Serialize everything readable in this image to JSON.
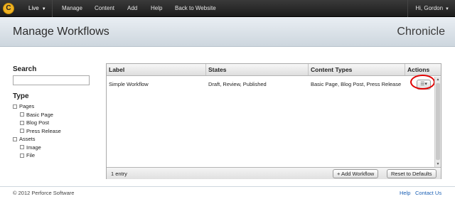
{
  "topnav": {
    "logo_letter": "C",
    "live_label": "Live",
    "links": [
      "Manage",
      "Content",
      "Add",
      "Help",
      "Back to Website"
    ],
    "user_label": "Hi, Gordon"
  },
  "header": {
    "title": "Manage Workflows",
    "brand": "Chronicle"
  },
  "sidebar": {
    "search_heading": "Search",
    "search_value": "",
    "type_heading": "Type",
    "tree": [
      {
        "label": "Pages",
        "level": 1
      },
      {
        "label": "Basic Page",
        "level": 2
      },
      {
        "label": "Blog Post",
        "level": 2
      },
      {
        "label": "Press Release",
        "level": 2
      },
      {
        "label": "Assets",
        "level": 1
      },
      {
        "label": "Image",
        "level": 2
      },
      {
        "label": "File",
        "level": 2
      }
    ]
  },
  "grid": {
    "columns": [
      "Label",
      "States",
      "Content Types",
      "Actions"
    ],
    "rows": [
      {
        "label": "Simple Workflow",
        "states": "Draft, Review, Published",
        "content_types": "Basic Page, Blog Post, Press Release"
      }
    ],
    "actions_icon": "menu-icon",
    "entry_count": "1 entry",
    "add_button": "+ Add Workflow",
    "reset_button": "Reset to Defaults"
  },
  "footer": {
    "copyright": "© 2012 Perforce Software",
    "help": "Help",
    "contact": "Contact Us"
  },
  "colors": {
    "logo": "#f0b323",
    "highlight_ring": "#e00000",
    "link": "#1a5fb4"
  }
}
